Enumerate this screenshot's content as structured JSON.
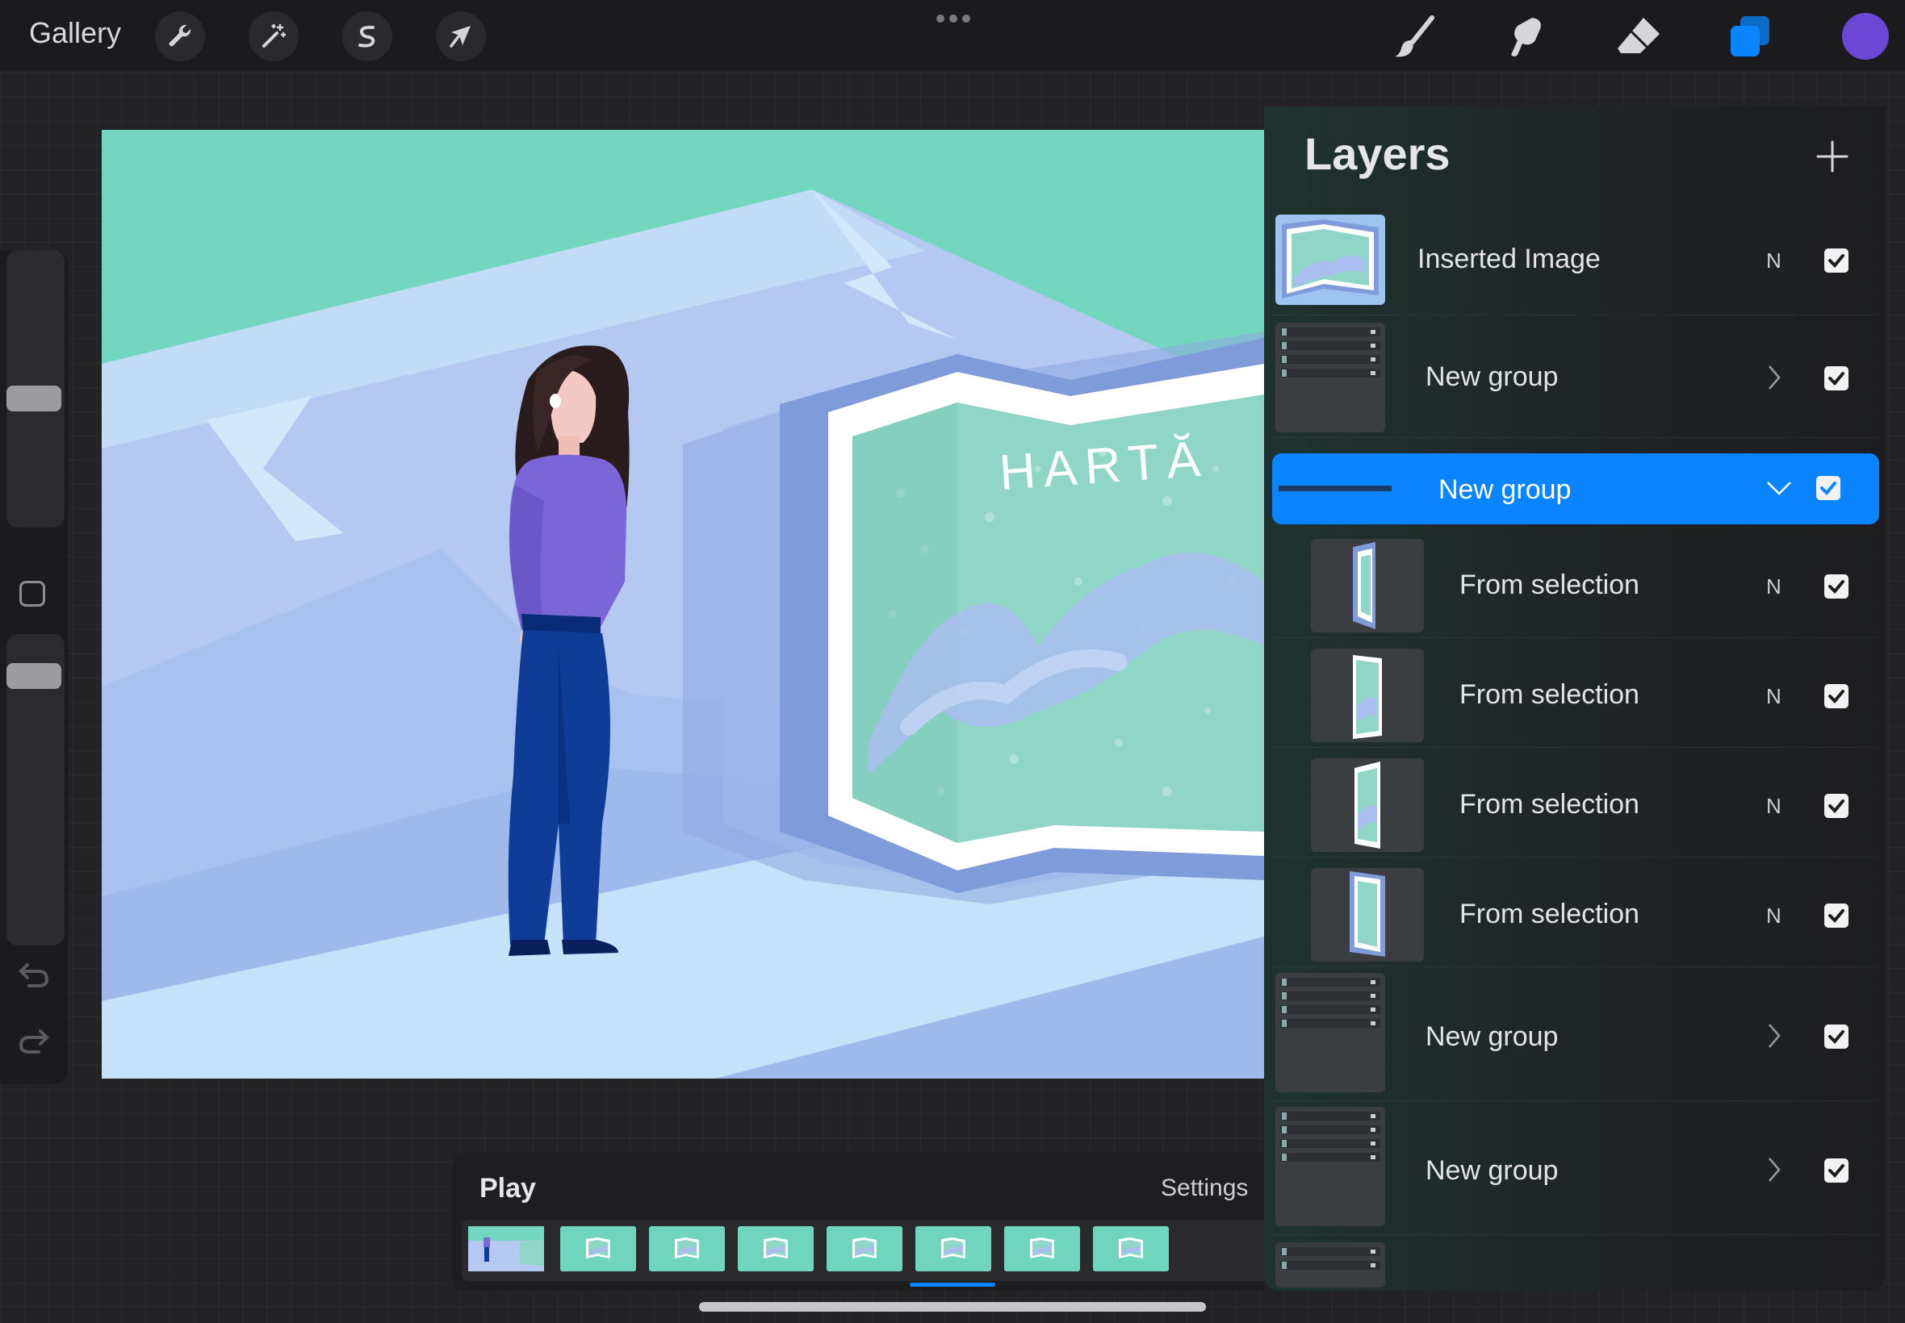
{
  "topbar": {
    "gallery_label": "Gallery",
    "left_tools": [
      "wrench-icon",
      "magic-wand-icon",
      "selection-s-icon",
      "transform-arrow-icon"
    ],
    "right_tools": [
      "brush-icon",
      "smudge-icon",
      "eraser-icon",
      "layers-icon"
    ],
    "active_tool": "layers-icon",
    "color_swatch": "#6b47d6"
  },
  "canvas": {
    "artwork_text": "HARTĂ",
    "colors": {
      "sky": "#72d7be",
      "wall": "#b4c8f2",
      "floor": "#a1bdee",
      "sweater": "#7a66d6",
      "jeans": "#0f3c96"
    }
  },
  "layers_panel": {
    "title": "Layers",
    "add_label": "+",
    "rows": [
      {
        "name": "Inserted Image",
        "blend": "N",
        "visible": true
      },
      {
        "name": "New group",
        "visible": true,
        "collapsed": true
      },
      {
        "name": "New group",
        "visible": true,
        "collapsed": false,
        "selected": true
      },
      {
        "name": "From selection",
        "blend": "N",
        "visible": true,
        "child": true
      },
      {
        "name": "From selection",
        "blend": "N",
        "visible": true,
        "child": true
      },
      {
        "name": "From selection",
        "blend": "N",
        "visible": true,
        "child": true
      },
      {
        "name": "From selection",
        "blend": "N",
        "visible": true,
        "child": true
      },
      {
        "name": "New group",
        "visible": true,
        "collapsed": true
      },
      {
        "name": "New group",
        "visible": true,
        "collapsed": true
      }
    ],
    "group_thumb_label": "From selection",
    "group_thumb_blend": "N",
    "accent_color": "#0a84ff"
  },
  "timeline": {
    "play_label": "Play",
    "settings_label": "Settings",
    "frame_count": 8,
    "active_frame": 6
  }
}
